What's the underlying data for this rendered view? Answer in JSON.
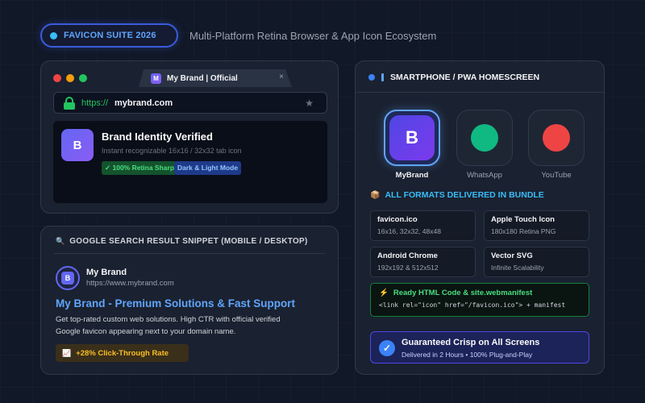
{
  "header": {
    "suite_label": "FAVICON SUITE 2026",
    "subtitle": "Multi-Platform Retina Browser & App Icon Ecosystem"
  },
  "browser": {
    "traffic_colors": [
      "#ef4444",
      "#f59e0b",
      "#22c55e"
    ],
    "tab": {
      "favicon_letter": "M",
      "title": "My Brand | Official",
      "close": "×"
    },
    "url": {
      "protocol": "https://",
      "domain": "mybrand.com",
      "bookmark_glyph": "★"
    },
    "content": {
      "logo_letter": "B",
      "title": "Brand Identity Verified",
      "subtitle": "Instant recognizable 16x16 / 32x32 tab icon",
      "badges": [
        "✓ 100% Retina Sharp",
        "Dark & Light Mode"
      ]
    }
  },
  "search": {
    "title": "GOOGLE SEARCH RESULT SNIPPET (MOBILE / DESKTOP)",
    "icon_glyph": "🔍",
    "result": {
      "favicon_letter": "B",
      "site_name": "My Brand",
      "url": "https://www.mybrand.com",
      "link_title": "My Brand - Premium Solutions & Fast Support",
      "description": "Get top-rated custom web solutions. High CTR with official verified Google favicon appearing next to your domain name."
    },
    "ctr_icon": "📈",
    "ctr_label": "+28% Click-Through Rate"
  },
  "phone": {
    "title": "SMARTPHONE / PWA HOMESCREEN",
    "apps": [
      {
        "name": "MyBrand",
        "letter": "B"
      },
      {
        "name": "WhatsApp",
        "color": "#10b981"
      },
      {
        "name": "YouTube",
        "color": "#ef4444"
      }
    ],
    "formats_icon": "📦",
    "formats_title": "ALL FORMATS DELIVERED IN BUNDLE",
    "formats": [
      {
        "name": "favicon.ico",
        "desc": "16x16, 32x32, 48x48"
      },
      {
        "name": "Apple Touch Icon",
        "desc": "180x180 Retina PNG"
      },
      {
        "name": "Android Chrome",
        "desc": "192x192 & 512x512"
      },
      {
        "name": "Vector SVG",
        "desc": "Infinite Scalability"
      }
    ],
    "code": {
      "icon": "⚡",
      "title": "Ready HTML Code & site.webmanifest",
      "line": "<link rel=\"icon\" href=\"/favicon.ico\"> + manifest"
    },
    "guarantee": {
      "check": "✓",
      "title": "Guaranteed Crisp on All Screens",
      "subtitle": "Delivered in 2 Hours • 100% Plug-and-Play"
    }
  }
}
